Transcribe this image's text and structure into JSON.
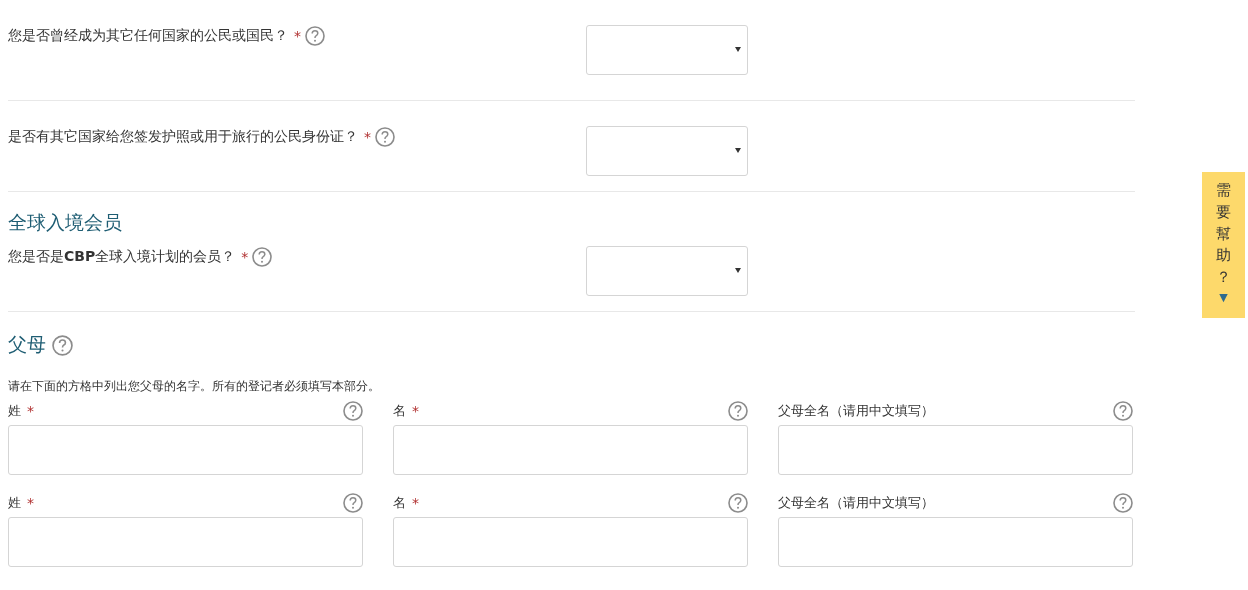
{
  "citizenship": {
    "questions": [
      {
        "label": "您是否曾经成为其它任何国家的公民或国民？",
        "mark": "*"
      },
      {
        "label": "是否有其它国家给您签发护照或用于旅行的公民身份证？",
        "mark": "*"
      }
    ]
  },
  "global_entry": {
    "heading": "全球入境会员",
    "questions": [
      {
        "label": "您是否是**CBP**全球入境计划的会员？",
        "mark": "*"
      }
    ]
  },
  "parents": {
    "heading": "父母",
    "instruction": "请在下面的方格中列出您父母的名字。所有的登记者必须填写本部分。",
    "rows": [
      [
        {
          "label": "姓",
          "mark": "*"
        },
        {
          "label": "名",
          "mark": "*"
        },
        {
          "label": "父母全名（请用中文填写）"
        }
      ],
      [
        {
          "label": "姓",
          "mark": "*"
        },
        {
          "label": "名",
          "mark": "*"
        },
        {
          "label": "父母全名（请用中文填写）"
        }
      ]
    ]
  },
  "help_tab": {
    "label": "需要幫助？",
    "arrow": "▼"
  }
}
